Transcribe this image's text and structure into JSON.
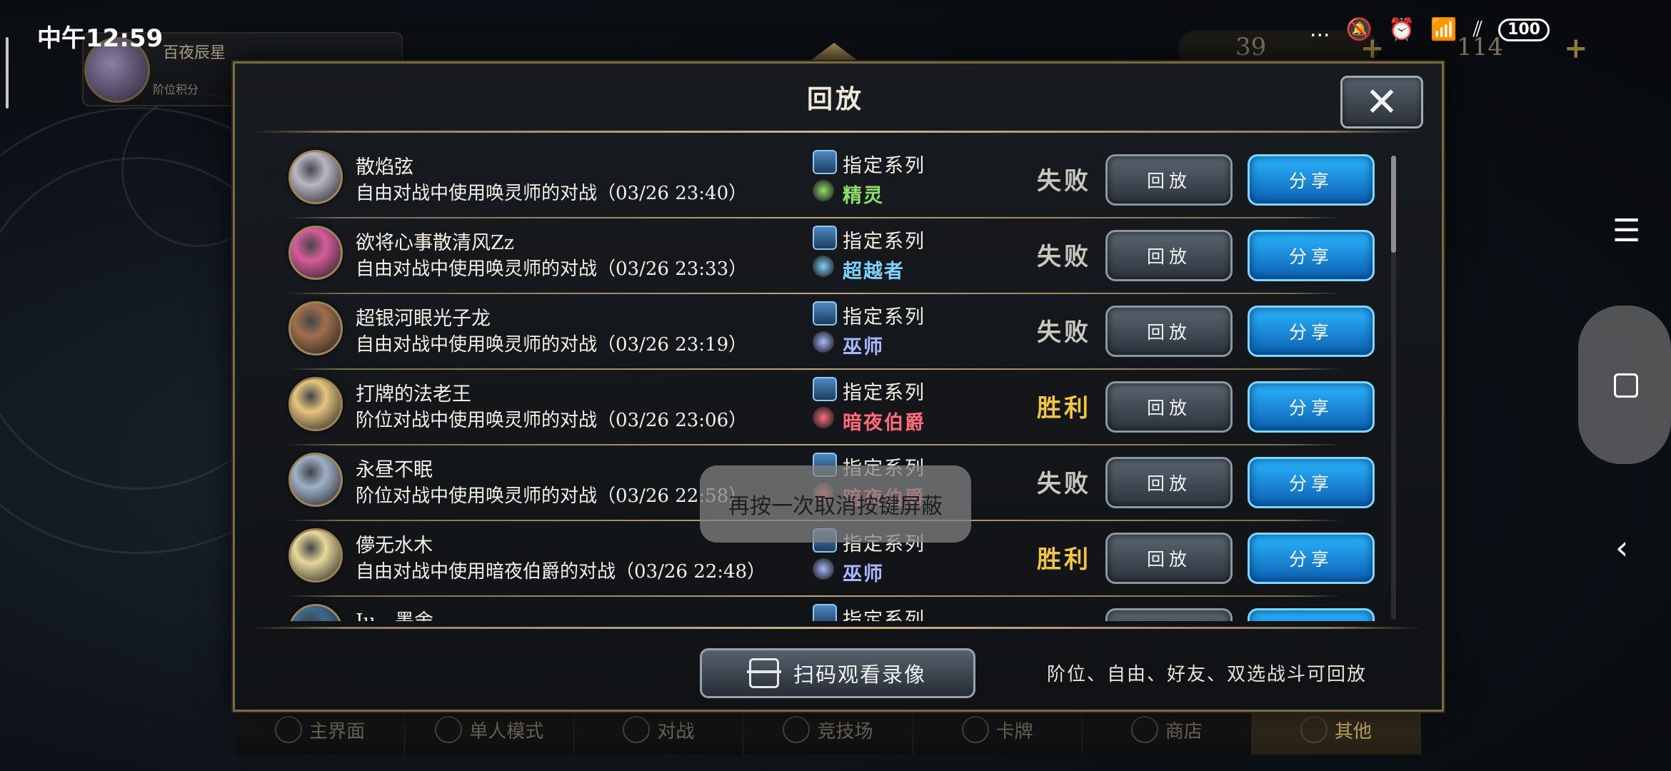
{
  "status_bar": {
    "time": "中午12:59",
    "more": "...",
    "battery": "100"
  },
  "background": {
    "player_title": "百夜辰星",
    "player_sub": "阶位积分",
    "resource_1": "39",
    "resource_2": "114"
  },
  "dialog": {
    "title": "回放",
    "close_label": "✕",
    "replay_label": "回放",
    "share_label": "分享",
    "category_label": "指定系列",
    "scan_button_label": "扫码观看录像",
    "hint_text": "阶位、自由、好友、双选战斗可回放",
    "rows": [
      {
        "player": "散焰弦",
        "description": "自由对战中使用唤灵师的对战（03/26 23:40）",
        "category": "指定系列",
        "class": "精灵",
        "class_color": "#8fe06a",
        "result": "失败"
      },
      {
        "player": "欲将心事散清风Zz",
        "description": "自由对战中使用唤灵师的对战（03/26 23:33）",
        "category": "指定系列",
        "class": "超越者",
        "class_color": "#7fd3ff",
        "result": "失败"
      },
      {
        "player": "超银河眼光子龙",
        "description": "自由对战中使用唤灵师的对战（03/26 23:19）",
        "category": "指定系列",
        "class": "巫师",
        "class_color": "#a7b8ff",
        "result": "失败"
      },
      {
        "player": "打牌的法老王",
        "description": "阶位对战中使用唤灵师的对战（03/26 23:06）",
        "category": "指定系列",
        "class": "暗夜伯爵",
        "class_color": "#ff6b7a",
        "result": "胜利"
      },
      {
        "player": "永昼不眠",
        "description": "阶位对战中使用唤灵师的对战（03/26 22:58）",
        "category": "指定系列",
        "class": "暗夜伯爵",
        "class_color": "#ff6b7a",
        "result": "失败"
      },
      {
        "player": "儚无水木",
        "description": "自由对战中使用暗夜伯爵的对战（03/26 22:48）",
        "category": "指定系列",
        "class": "巫师",
        "class_color": "#a7b8ff",
        "result": "胜利"
      },
      {
        "player": "Iu、墨舍",
        "description": "",
        "category": "指定系列",
        "class": "",
        "class_color": "#a7b8ff",
        "result": ""
      }
    ]
  },
  "toast": "再按一次取消按键屏蔽",
  "bottom_nav": [
    "主界面",
    "单人模式",
    "对战",
    "竞技场",
    "卡牌",
    "商店",
    "其他"
  ],
  "colors": {
    "win": "#f2c640",
    "lose": "#c9c6bd",
    "accent_gold": "#bca67a",
    "share_blue": "#1a8fe0"
  },
  "icons": {
    "close": "close-icon",
    "menu": "menu-icon",
    "home": "home-icon",
    "back": "back-icon",
    "scan": "scan-icon"
  }
}
